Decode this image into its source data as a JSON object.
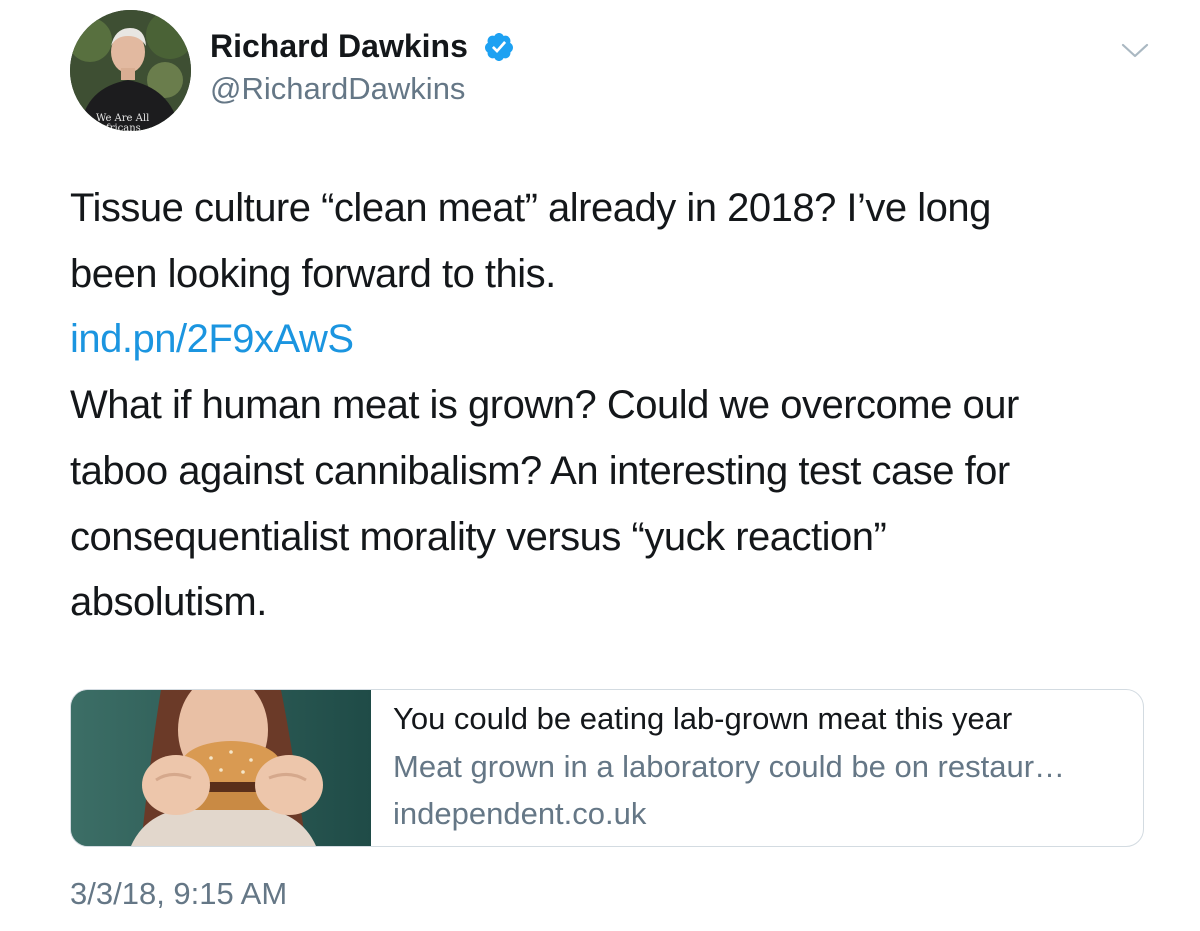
{
  "author": {
    "name": "Richard Dawkins",
    "handle": "@RichardDawkins",
    "verified": true,
    "avatar_shirt_text": "We Are All Africans"
  },
  "tweet": {
    "lines_before_link": [
      "Tissue culture “clean meat” already in 2018? I’ve long",
      "been looking forward to this."
    ],
    "link": "ind.pn/2F9xAwS",
    "lines_after_link": [
      "What if human meat is grown? Could we overcome our",
      "taboo against cannibalism? An interesting test case for",
      "consequentialist morality versus “yuck reaction”",
      "absolutism."
    ]
  },
  "card": {
    "title": "You could be eating lab-grown meat this year",
    "description": "Meat grown in a laboratory could be on restaur…",
    "domain": "independent.co.uk",
    "image": "woman-eating-burger-photo"
  },
  "timestamp": "3/3/18, 9:15 AM",
  "icons": {
    "verified": "verified-badge-icon",
    "menu": "chevron-down-icon"
  },
  "colors": {
    "link": "#1b95e0",
    "verified": "#1da1f2",
    "secondary_text": "#657786",
    "primary_text": "#14171a",
    "card_border": "#d3dbe1"
  }
}
